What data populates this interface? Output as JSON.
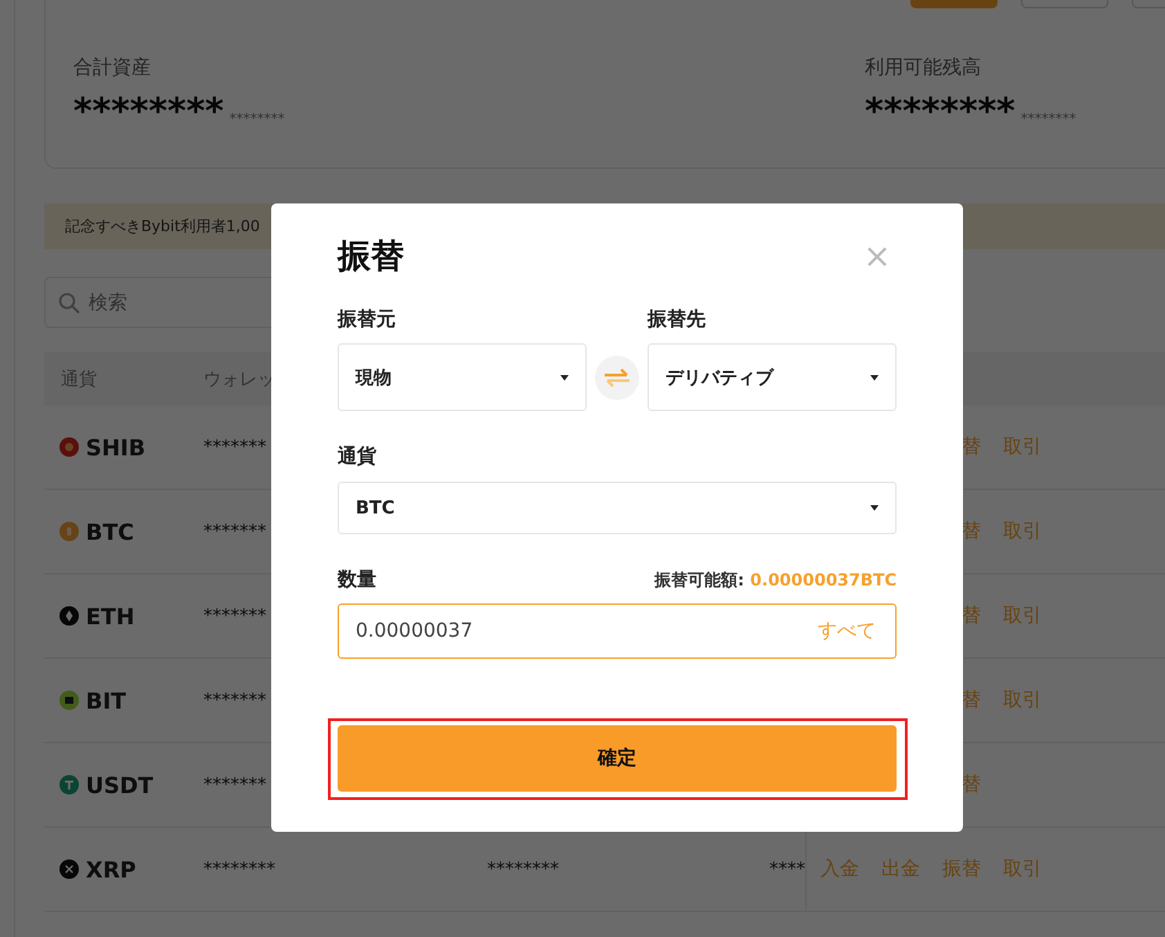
{
  "header_buttons": [
    {
      "kind": "primary"
    },
    {
      "kind": "outline"
    },
    {
      "kind": "outline"
    }
  ],
  "summary": [
    {
      "label": "合計資産",
      "value": "********",
      "sub_value": "********"
    },
    {
      "label": "利用可能残高",
      "value": "********",
      "sub_value": "********"
    }
  ],
  "banner": {
    "text": "記念すべきBybit利用者1,00"
  },
  "search": {
    "placeholder": "検索"
  },
  "table": {
    "columns": [
      "通貨",
      "ウォレッ"
    ],
    "rows": [
      {
        "kind": "shib",
        "cells": [
          "SHIB",
          "*******"
        ],
        "actions": {
          "transfer": "替",
          "trade": "取引"
        }
      },
      {
        "kind": "btc",
        "cells": [
          "BTC",
          "*******"
        ],
        "actions": {
          "transfer": "替",
          "trade": "取引"
        }
      },
      {
        "kind": "eth",
        "cells": [
          "ETH",
          "*******"
        ],
        "actions": {
          "transfer": "替",
          "trade": "取引"
        }
      },
      {
        "kind": "bit",
        "cells": [
          "BIT",
          "*******"
        ],
        "actions": {
          "transfer": "替",
          "trade": "取引"
        }
      },
      {
        "kind": "usdt",
        "cells": [
          "USDT",
          "*******"
        ],
        "actions": {
          "transfer": "替"
        }
      },
      {
        "kind": "xrp",
        "cells": [
          "XRP",
          "********",
          "********",
          "****"
        ],
        "actions": {
          "deposit": "入金",
          "withdraw": "出金",
          "transfer": "振替",
          "trade": "取引"
        }
      }
    ]
  },
  "dialog": {
    "title": "振替",
    "close": "×",
    "from": {
      "label": "振替元",
      "value": "現物"
    },
    "to": {
      "label": "振替先",
      "value": "デリバティブ"
    },
    "currency": {
      "label": "通貨",
      "value": "BTC"
    },
    "amount": {
      "label": "数量",
      "available_label": "振替可能額:",
      "available_value": "0.00000037BTC",
      "value": "0.00000037",
      "max_button": "すべて"
    },
    "confirm_button": "確定",
    "confirm_highlighted": true
  }
}
